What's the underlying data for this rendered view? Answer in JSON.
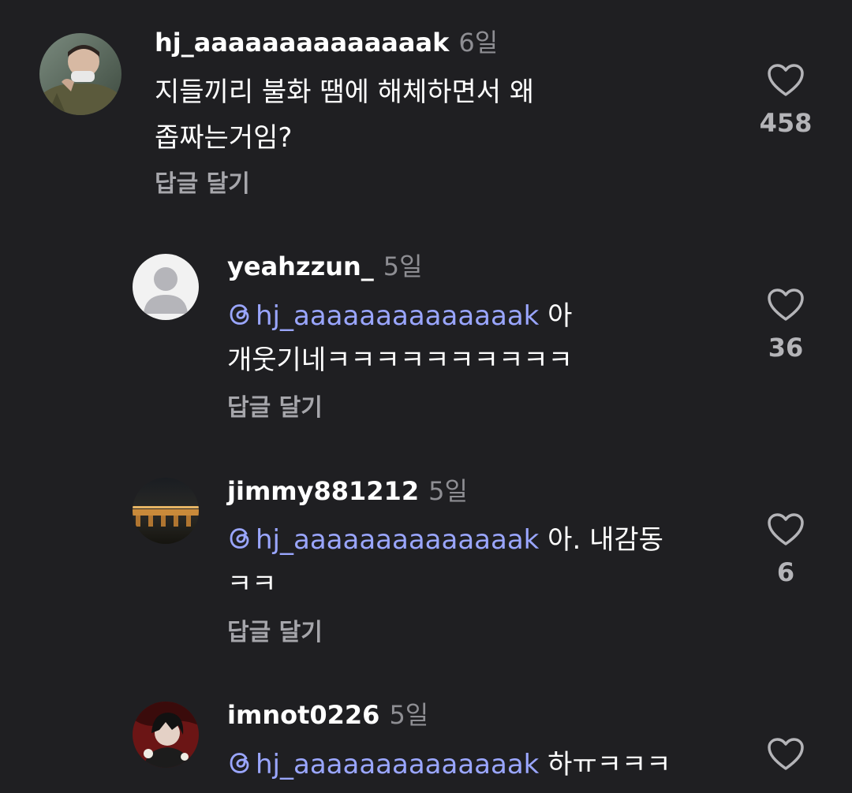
{
  "comments": [
    {
      "username": "hj_aaaaaaaaaaaaaak",
      "time": "6일",
      "text_line1": "지들끼리 불화 땜에 해체하면서 왜",
      "text_line2": "좁짜는거임?",
      "reply_label": "답글 달기",
      "likes": "458"
    },
    {
      "username": "yeahzzun_",
      "time": "5일",
      "mention": "hj_aaaaaaaaaaaaaak",
      "text_after_mention": " 아",
      "text_line2": "개웃기네ㅋㅋㅋㅋㅋㅋㅋㅋㅋㅋ",
      "reply_label": "답글 달기",
      "likes": "36"
    },
    {
      "username": "jimmy881212",
      "time": "5일",
      "mention": "hj_aaaaaaaaaaaaaak",
      "text_after_mention": " 아.  내감동",
      "text_line2": "ㅋㅋ",
      "reply_label": "답글 달기",
      "likes": "6"
    },
    {
      "username": "imnot0226",
      "time": "5일",
      "mention": "hj_aaaaaaaaaaaaaak",
      "text_after_mention": " 하ㅠㅋㅋㅋ"
    }
  ],
  "icons": {
    "like": "heart-outline-icon",
    "mention": "threads-at-icon"
  },
  "colors": {
    "background": "#1f1f22",
    "mention": "#9aa6ff",
    "secondary_text": "#a6a6ab"
  }
}
